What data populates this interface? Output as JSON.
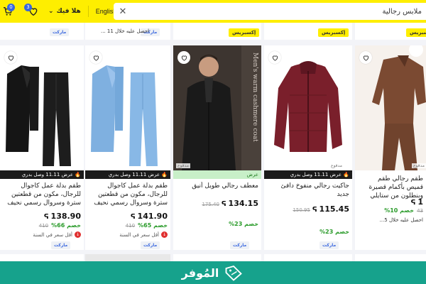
{
  "topbar": {
    "cart_count": "0",
    "wishlist_count": "3",
    "greeting": "هلا فيك",
    "language": "English",
    "search_value": "ملابس رجالية"
  },
  "top_row": {
    "partial_title": "احصل عليه خلال 11 ...",
    "express_label": "إكسبريس",
    "market_label": "ماركت"
  },
  "products": [
    {
      "title": "طقم بدلة عمل كاجوال للرجال، مكون من قطعتين سترة وسروال رسمي نحيف",
      "promo": "عرض 11.11 وصل بدري",
      "price": "138.90",
      "old_price": "410",
      "discount": "خصم 66%",
      "lowest": "أقل سعر في السنة",
      "market_label": "ماركت",
      "colors": {
        "jacket": "#141414",
        "pants": "#1b1b1b",
        "bg": "#ffffff"
      }
    },
    {
      "title": "طقم بدلة عمل كاجوال للرجال، مكون من قطعتين سترة وسروال رسمي نحيف",
      "promo": "عرض 11.11 وصل بدري",
      "price": "141.90",
      "old_price": "410",
      "discount": "خصم 65%",
      "lowest": "أقل سعر في السنة",
      "market_label": "ماركت",
      "colors": {
        "jacket": "#7fb0e0",
        "pants": "#88b8e6",
        "bg": "#ffffff"
      }
    },
    {
      "title": "معطف رجالي طويل أنيق",
      "promo": "عرض",
      "price": "134.15",
      "old_price": "175.40",
      "discount": "خصم 23%",
      "market_label": "ماركت",
      "image_caption": "Men's warm cashmere coat",
      "badge": "مدفوع",
      "colors": {
        "coat": "#1a1a1a",
        "bg": "#3d3530"
      }
    },
    {
      "title": "جاكيت رجالي منفوخ دافئ جديد",
      "promo": "عرض 11.11 وصل بدري",
      "price": "115.45",
      "old_price": "150.95",
      "discount": "خصم 23%",
      "market_label": "ماركت",
      "badge": "مدفوع",
      "colors": {
        "jacket": "#7a1f2b",
        "bg": "#ffffff"
      }
    },
    {
      "title": "طقم رجالي طقم قميص بأكمام قصيرة وبنطلون من ستايلي",
      "price": "1",
      "old_price": "43",
      "discount": "خصم 10%",
      "extra": "احصل عليه خلال 5...",
      "badge": "مدفوع",
      "colors": {
        "set": "#7b4a32",
        "bg": "#f6f1ec"
      }
    }
  ],
  "footer": {
    "brand": "المُوفر"
  }
}
